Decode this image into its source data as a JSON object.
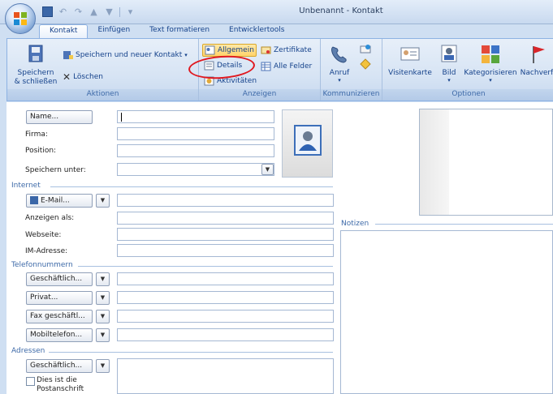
{
  "window": {
    "title": "Unbenannt - Kontakt"
  },
  "ribbon": {
    "tabs": [
      "Kontakt",
      "Einfügen",
      "Text formatieren",
      "Entwicklertools"
    ],
    "groups": {
      "aktionen": {
        "label": "Aktionen",
        "save_close": "Speichern\n& schließen",
        "save_new": "Speichern und neuer Kontakt",
        "delete": "Löschen"
      },
      "anzeigen": {
        "label": "Anzeigen",
        "general": "Allgemein",
        "details": "Details",
        "activities": "Aktivitäten",
        "certificates": "Zertifikate",
        "all_fields": "Alle Felder"
      },
      "kommunizieren": {
        "label": "Kommunizieren",
        "call": "Anruf"
      },
      "optionen": {
        "label": "Optionen",
        "business_card": "Visitenkarte",
        "picture": "Bild",
        "categorize": "Kategorisieren",
        "follow_up": "Nachverf"
      }
    }
  },
  "form": {
    "name_button": "Name...",
    "company": "Firma:",
    "position": "Position:",
    "file_as": "Speichern unter:",
    "internet_section": "Internet",
    "email_button": "E-Mail...",
    "display_as": "Anzeigen als:",
    "website": "Webseite:",
    "im": "IM-Adresse:",
    "phone_section": "Telefonnummern",
    "phone_business": "Geschäftlich...",
    "phone_private": "Privat...",
    "phone_fax": "Fax geschäftl...",
    "phone_mobile": "Mobiltelefon...",
    "address_section": "Adressen",
    "address_business": "Geschäftlich...",
    "mailing_address_line1": "Dies ist die",
    "mailing_address_line2": "Postanschrift",
    "notes_section": "Notizen"
  }
}
